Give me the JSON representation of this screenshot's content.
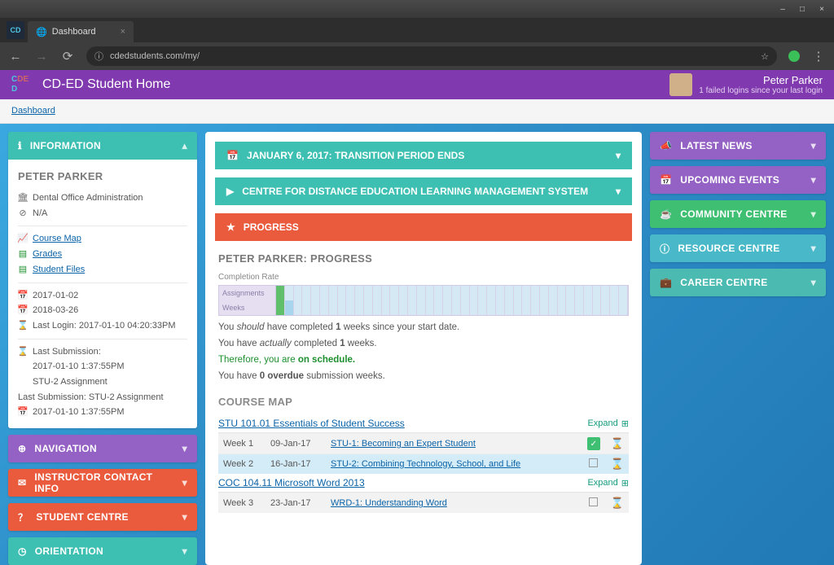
{
  "browser": {
    "tab_title": "Dashboard",
    "url": "cdedstudents.com/my/",
    "window_buttons": {
      "min": "–",
      "max": "□",
      "close": "×"
    }
  },
  "header": {
    "site_title": "CD-ED Student Home",
    "user_name": "Peter Parker",
    "login_note": "1 failed logins since your last login"
  },
  "breadcrumb": {
    "label": "Dashboard"
  },
  "left": {
    "information": {
      "title": "INFORMATION",
      "name": "PETER PARKER",
      "program": "Dental Office Administration",
      "status": "N/A",
      "course_map": "Course Map",
      "grades": "Grades",
      "student_files": "Student Files",
      "date1": "2017-01-02",
      "date2": "2018-03-26",
      "last_login": "Last Login: 2017-01-10 04:20:33PM",
      "last_sub_label": "Last Submission:",
      "last_sub_time": "2017-01-10 1:37:55PM",
      "last_sub_item": "STU-2 Assignment",
      "last_sub_line2": "Last Submission: STU-2 Assignment",
      "last_sub_line3": "2017-01-10 1:37:55PM"
    },
    "panels": {
      "navigation": "NAVIGATION",
      "instructor": "INSTRUCTOR CONTACT INFO",
      "student_centre": "STUDENT CENTRE",
      "orientation": "ORIENTATION"
    }
  },
  "main": {
    "banner1": "JANUARY 6, 2017: TRANSITION PERIOD ENDS",
    "banner2": "CENTRE FOR DISTANCE EDUCATION LEARNING MANAGEMENT SYSTEM",
    "progress_title": "PROGRESS",
    "progress_header": "PETER PARKER: PROGRESS",
    "completion_label": "Completion Rate",
    "chart_row1": "Assignments",
    "chart_row2": "Weeks",
    "msg_should_pre": "You ",
    "msg_should_i": "should",
    "msg_should_post": " have completed ",
    "msg_should_n": "1",
    "msg_should_end": " weeks since your start date.",
    "msg_actual_pre": "You have ",
    "msg_actual_i": "actually",
    "msg_actual_post": " completed ",
    "msg_actual_n": "1",
    "msg_actual_end": " weeks.",
    "msg_sched_pre": "Therefore, you are ",
    "msg_sched_flag": "on schedule.",
    "msg_overdue_pre": "You have ",
    "msg_overdue_n": "0 overdue",
    "msg_overdue_end": " submission weeks.",
    "course_map_title": "COURSE MAP",
    "courses": [
      {
        "title": "STU 101.01 Essentials of Student Success",
        "expand": "Expand",
        "rows": [
          {
            "wk": "Week 1",
            "date": "09-Jan-17",
            "link": "STU-1: Becoming an Expert Student",
            "done": true
          },
          {
            "wk": "Week 2",
            "date": "16-Jan-17",
            "link": "STU-2: Combining Technology, School, and Life",
            "done": false
          }
        ]
      },
      {
        "title": "COC 104.11 Microsoft Word 2013",
        "expand": "Expand",
        "rows": [
          {
            "wk": "Week 3",
            "date": "23-Jan-17",
            "link": "WRD-1: Understanding Word",
            "done": false
          }
        ]
      }
    ]
  },
  "right": {
    "latest_news": "LATEST NEWS",
    "upcoming": "UPCOMING EVENTS",
    "community": "COMMUNITY CENTRE",
    "resource": "RESOURCE CENTRE",
    "career": "CAREER CENTRE"
  }
}
